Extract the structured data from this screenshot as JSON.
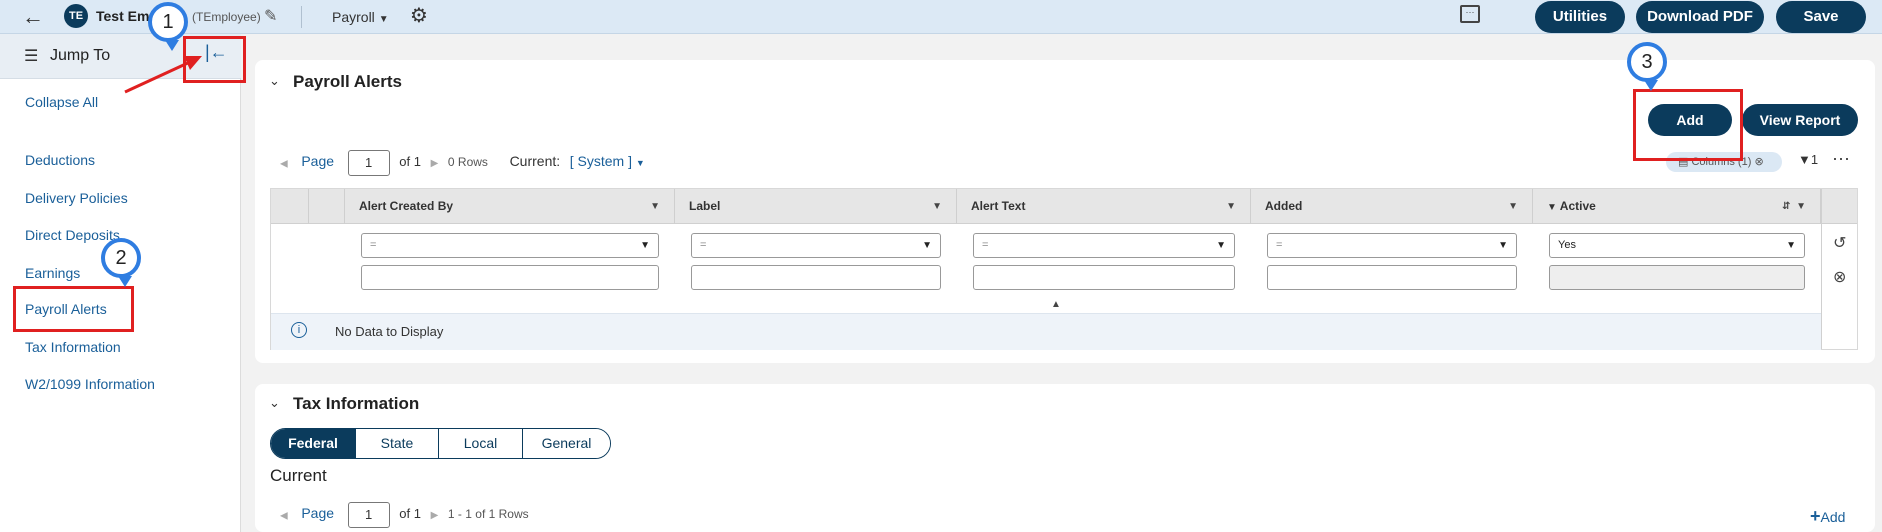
{
  "topbar": {
    "avatar_initials": "TE",
    "employee_name": "Test Emp",
    "employee_code": "(TEmployee)",
    "payroll_menu": "Payroll",
    "utilities_label": "Utilities",
    "download_pdf_label": "Download PDF",
    "save_label": "Save"
  },
  "sidebar": {
    "jump_to_label": "Jump To",
    "collapse_all_label": "Collapse All",
    "items": [
      {
        "label": "Deductions"
      },
      {
        "label": "Delivery Policies"
      },
      {
        "label": "Direct Deposits"
      },
      {
        "label": "Earnings"
      },
      {
        "label": "Payroll Alerts"
      },
      {
        "label": "Tax Information"
      },
      {
        "label": "W2/1099 Information"
      }
    ]
  },
  "payroll_alerts": {
    "title": "Payroll Alerts",
    "add_label": "Add",
    "view_report_label": "View Report",
    "pager": {
      "page_label": "Page",
      "page_value": "1",
      "of_label": "of 1",
      "rows_label": "0 Rows",
      "current_label": "Current:",
      "current_value": "[ System ]"
    },
    "columns_chip": "Columns (1)",
    "filter_count": "1",
    "columns": [
      {
        "header": "Alert Created By",
        "filter_op": "="
      },
      {
        "header": "Label",
        "filter_op": "="
      },
      {
        "header": "Alert Text",
        "filter_op": "="
      },
      {
        "header": "Added",
        "filter_op": "="
      },
      {
        "header": "Active",
        "filter_op": "Yes"
      }
    ],
    "no_data": "No Data to Display"
  },
  "tax_information": {
    "title": "Tax Information",
    "tabs": [
      {
        "label": "Federal"
      },
      {
        "label": "State"
      },
      {
        "label": "Local"
      },
      {
        "label": "General"
      }
    ],
    "current_heading": "Current",
    "pager": {
      "page_label": "Page",
      "page_value": "1",
      "of_label": "of 1",
      "rows_label": "1 - 1 of 1 Rows"
    },
    "add_label": "Add"
  },
  "annotations": {
    "markers": [
      "1",
      "2",
      "3"
    ]
  },
  "colors": {
    "accent": "#0b3b5c",
    "link": "#1a5f99",
    "annotation_red": "#e02020",
    "marker_blue": "#2f7de1"
  }
}
